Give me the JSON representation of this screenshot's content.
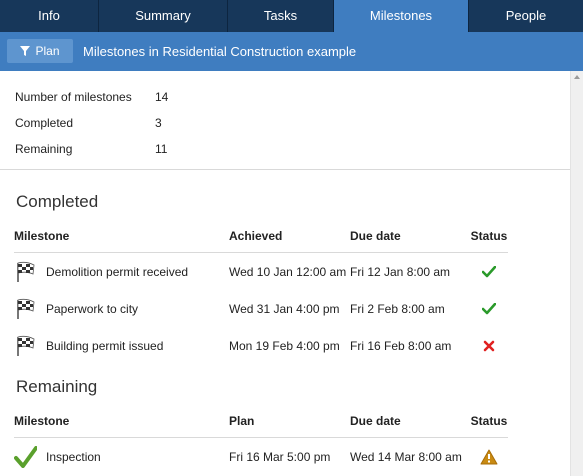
{
  "tabs": [
    {
      "label": "Info",
      "active": false
    },
    {
      "label": "Summary",
      "active": false
    },
    {
      "label": "Tasks",
      "active": false
    },
    {
      "label": "Milestones",
      "active": true
    },
    {
      "label": "People",
      "active": false
    }
  ],
  "toolbar": {
    "plan_label": "Plan",
    "title": "Milestones in Residential Construction example"
  },
  "stats": {
    "number_label": "Number of milestones",
    "number_value": "14",
    "completed_label": "Completed",
    "completed_value": "3",
    "remaining_label": "Remaining",
    "remaining_value": "11"
  },
  "completed": {
    "title": "Completed",
    "headers": {
      "milestone": "Milestone",
      "achieved": "Achieved",
      "due": "Due date",
      "status": "Status"
    },
    "rows": [
      {
        "milestone": "Demolition permit received",
        "achieved": "Wed 10 Jan 12:00 am",
        "due": "Fri 12 Jan 8:00 am",
        "status": "check-icon"
      },
      {
        "milestone": "Paperwork to city",
        "achieved": "Wed 31 Jan 4:00 pm",
        "due": "Fri 2 Feb 8:00 am",
        "status": "check-icon"
      },
      {
        "milestone": "Building permit issued",
        "achieved": "Mon 19 Feb 4:00 pm",
        "due": "Fri 16 Feb 8:00 am",
        "status": "cross-icon"
      }
    ]
  },
  "remaining": {
    "title": "Remaining",
    "headers": {
      "milestone": "Milestone",
      "plan": "Plan",
      "due": "Due date",
      "status": "Status"
    },
    "rows": [
      {
        "milestone": "Inspection",
        "plan": "Fri 16 Mar 5:00 pm",
        "due": "Wed 14 Mar 8:00 am",
        "status": "warning-icon"
      }
    ]
  },
  "colors": {
    "tabbar": "#17375a",
    "accent": "#3f7dc0",
    "ok": "#2a9a2a",
    "fail": "#e02020",
    "warn": "#c98a12"
  }
}
